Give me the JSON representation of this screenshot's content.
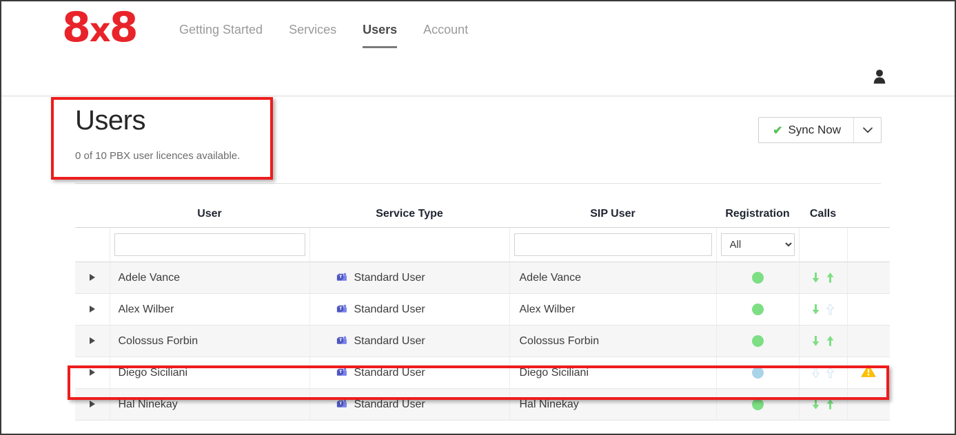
{
  "brand": {
    "logo_first": "8",
    "logo_x": "x",
    "logo_last": "8",
    "logo_color": "#e8242a"
  },
  "nav": {
    "items": [
      {
        "label": "Getting Started",
        "active": false
      },
      {
        "label": "Services",
        "active": false
      },
      {
        "label": "Users",
        "active": true
      },
      {
        "label": "Account",
        "active": false
      }
    ],
    "avatar_icon": "user-avatar-icon"
  },
  "page": {
    "title": "Users",
    "subtitle": "0 of 10 PBX user licences available."
  },
  "toolbar": {
    "sync_label": "Sync Now",
    "sync_check_icon": "green-check-icon",
    "sync_caret_icon": "chevron-down-icon",
    "check_color": "#57c257"
  },
  "table": {
    "headers": {
      "expand": "",
      "user": "User",
      "service_type": "Service Type",
      "sip_user": "SIP User",
      "registration": "Registration",
      "calls": "Calls",
      "warning": ""
    },
    "filters": {
      "user_value": "",
      "user_placeholder": "",
      "sip_value": "",
      "sip_placeholder": "",
      "registration_selected": "All",
      "registration_options": [
        "All"
      ]
    },
    "rows": [
      {
        "expand_icon": "expand-triangle-icon",
        "user": "Adele Vance",
        "service_icon": "microsoft-teams-icon",
        "service_type": "Standard User",
        "sip_user": "Adele Vance",
        "registration_status": "registered",
        "registration_color": "#7ede84",
        "call_in": "active",
        "call_out": "active",
        "warning": false
      },
      {
        "expand_icon": "expand-triangle-icon",
        "user": "Alex Wilber",
        "service_icon": "microsoft-teams-icon",
        "service_type": "Standard User",
        "sip_user": "Alex Wilber",
        "registration_status": "registered",
        "registration_color": "#7ede84",
        "call_in": "active",
        "call_out": "inactive",
        "warning": false
      },
      {
        "expand_icon": "expand-triangle-icon",
        "user": "Colossus Forbin",
        "service_icon": "microsoft-teams-icon",
        "service_type": "Standard User",
        "sip_user": "Colossus Forbin",
        "registration_status": "registered",
        "registration_color": "#7ede84",
        "call_in": "active",
        "call_out": "active",
        "warning": false
      },
      {
        "expand_icon": "expand-triangle-icon",
        "user": "Diego Siciliani",
        "service_icon": "microsoft-teams-icon",
        "service_type": "Standard User",
        "sip_user": "Diego Siciliani",
        "registration_status": "not-registered",
        "registration_color": "#a9d4e8",
        "call_in": "inactive",
        "call_out": "inactive",
        "warning": true,
        "warning_icon": "warning-triangle-icon",
        "warning_color": "#ffc107"
      },
      {
        "expand_icon": "expand-triangle-icon",
        "user": "Hal Ninekay",
        "service_icon": "microsoft-teams-icon",
        "service_type": "Standard User",
        "sip_user": "Hal Ninekay",
        "registration_status": "registered",
        "registration_color": "#7ede84",
        "call_in": "active",
        "call_out": "active",
        "warning": false
      }
    ]
  },
  "annotations": {
    "color": "#ee1c1c",
    "boxes": [
      {
        "name": "users-title-highlight"
      },
      {
        "name": "diego-siciliani-row-highlight"
      }
    ]
  }
}
